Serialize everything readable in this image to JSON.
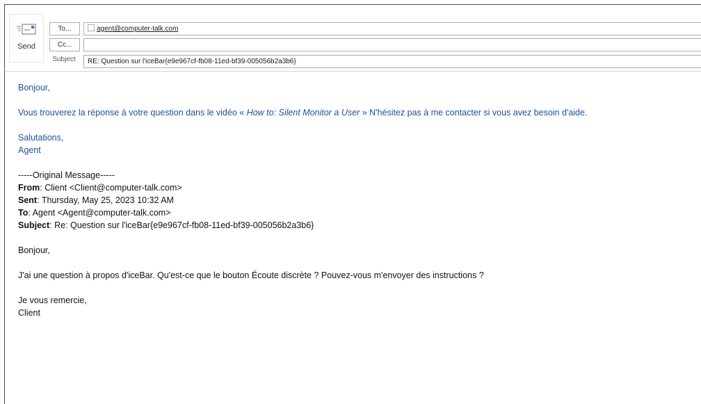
{
  "compose": {
    "send_label": "Send",
    "to_label": "To...",
    "cc_label": "Cc...",
    "subject_label": "Subject",
    "to_recipient": "agent@computer-talk.com",
    "cc_value": "",
    "subject_value": "RE: Question sur l'iceBar{e9e967cf-fb08-11ed-bf39-005056b2a3b6}"
  },
  "reply": {
    "greeting": "Bonjour,",
    "line_before_title": "Vous trouverez la réponse à votre question dans le vidéo « ",
    "video_title": "How to: Silent Monitor a User",
    "line_after_title": " » N'hésitez pas à me contacter si vous avez besoin d'aide.",
    "closing": "Salutations,",
    "signature": "Agent"
  },
  "original": {
    "separator": "-----Original Message-----",
    "from_label": "From",
    "from_value": ": Client <Client@computer-talk.com>",
    "sent_label": "Sent",
    "sent_value": ": Thursday, May 25, 2023 10:32 AM",
    "to_label": "To",
    "to_value": ": Agent <Agent@computer-talk.com>",
    "subject_label": "Subject",
    "subject_value": ": Re: Question sur l'iceBar{e9e967cf-fb08-11ed-bf39-005056b2a3b6}",
    "greeting": "Bonjour,",
    "question": "J'ai une question à propos d'iceBar. Qu'est-ce que le bouton Écoute discrète ? Pouvez-vous m'envoyer des instructions ?",
    "closing": "Je vous remercie,",
    "signature": "Client"
  },
  "icons": {
    "send": "send-envelope-icon"
  },
  "colors": {
    "reply_text": "#1f4e9b",
    "original_text": "#111111"
  }
}
